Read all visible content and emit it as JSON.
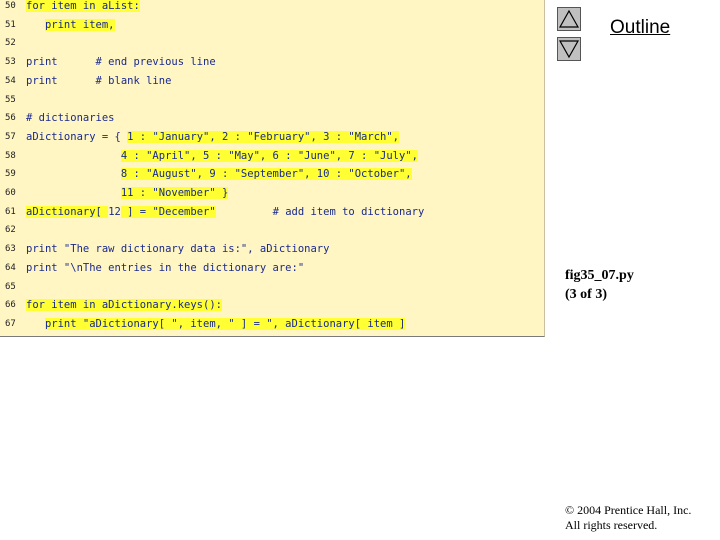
{
  "code_lines": [
    {
      "num": "50",
      "segments": [
        {
          "t": "for item in aList:",
          "hl": true
        }
      ]
    },
    {
      "num": "51",
      "segments": [
        {
          "t": "   ",
          "hl": false
        },
        {
          "t": "print item,",
          "hl": true
        }
      ]
    },
    {
      "num": "52",
      "segments": []
    },
    {
      "num": "53",
      "segments": [
        {
          "t": "print      # end previous line",
          "hl": false
        }
      ]
    },
    {
      "num": "54",
      "segments": [
        {
          "t": "print      # blank line",
          "hl": false
        }
      ]
    },
    {
      "num": "55",
      "segments": []
    },
    {
      "num": "56",
      "segments": [
        {
          "t": "# dictionaries",
          "hl": false
        }
      ]
    },
    {
      "num": "57",
      "segments": [
        {
          "t": "aDictionary = { ",
          "hl": false
        },
        {
          "t": "1 : \"January\", 2 : \"February\", 3 : \"March\",",
          "hl": true
        }
      ]
    },
    {
      "num": "58",
      "segments": [
        {
          "t": "               ",
          "hl": false
        },
        {
          "t": "4 : \"April\", 5 : \"May\", 6 : \"June\", 7 : \"July\",",
          "hl": true
        }
      ]
    },
    {
      "num": "59",
      "segments": [
        {
          "t": "               ",
          "hl": false
        },
        {
          "t": "8 : \"August\", 9 : \"September\", 10 : \"October\",",
          "hl": true
        }
      ]
    },
    {
      "num": "60",
      "segments": [
        {
          "t": "               ",
          "hl": false
        },
        {
          "t": "11 : \"November\" }",
          "hl": true
        }
      ]
    },
    {
      "num": "61",
      "segments": [
        {
          "t": "aDictionary[ ",
          "hl": true
        },
        {
          "t": "12",
          "hl": false
        },
        {
          "t": " ] = \"December\"",
          "hl": true
        },
        {
          "t": "         # add item to dictionary",
          "hl": false
        }
      ]
    },
    {
      "num": "62",
      "segments": []
    },
    {
      "num": "63",
      "segments": [
        {
          "t": "print \"The raw dictionary data is:\"",
          "hl": false
        },
        {
          "t": ", aDictionary",
          "hl": false
        }
      ]
    },
    {
      "num": "64",
      "segments": [
        {
          "t": "print \"\\nThe entries in the dictionary are:\"",
          "hl": false
        }
      ]
    },
    {
      "num": "65",
      "segments": []
    },
    {
      "num": "66",
      "segments": [
        {
          "t": "for item in aDictionary.keys():",
          "hl": true
        }
      ]
    },
    {
      "num": "67",
      "segments": [
        {
          "t": "   ",
          "hl": false
        },
        {
          "t": "print \"aDictionary[ \", item, \" ] = \", aDictionary[ item ]",
          "hl": true
        }
      ]
    }
  ],
  "sidebar": {
    "title": "Outline",
    "file_name": "fig35_07.py",
    "page_info": "(3 of 3)",
    "copyright_line1": "© 2004 Prentice Hall, Inc.",
    "copyright_line2": "All rights reserved."
  }
}
